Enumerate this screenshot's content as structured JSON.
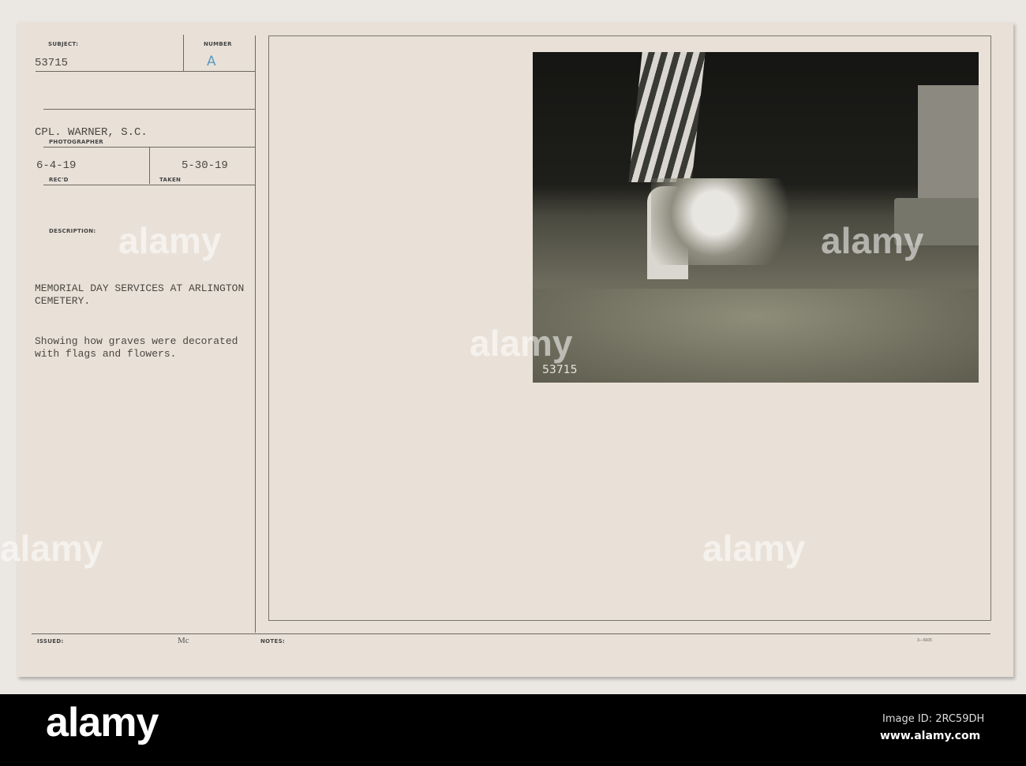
{
  "card": {
    "subject_label": "SUBJECT:",
    "subject_value": "53715",
    "number_label": "NUMBER",
    "number_value": "A",
    "photographer_value": "CPL. WARNER, S.C.",
    "photographer_label": "PHOTOGRAPHER",
    "recd_value": "6-4-19",
    "recd_label": "REC'D",
    "taken_value": "5-30-19",
    "taken_label": "TAKEN",
    "description_label": "DESCRIPTION:",
    "description_lines": [
      "MEMORIAL DAY SERVICES AT ARLINGTON",
      "CEMETERY.",
      "Showing how graves were decorated",
      "with flags and flowers."
    ],
    "issued_label": "ISSUED:",
    "issued_value": "Mc",
    "notes_label": "NOTES:",
    "form_number": "3—5605",
    "photo_number": "53715"
  },
  "watermark": "alamy",
  "footer": {
    "brand": "alamy",
    "image_id": "Image ID: 2RC59DH",
    "url": "www.alamy.com"
  },
  "colors": {
    "card": "#e9e1d8",
    "stamp": "#5a9bc0"
  }
}
